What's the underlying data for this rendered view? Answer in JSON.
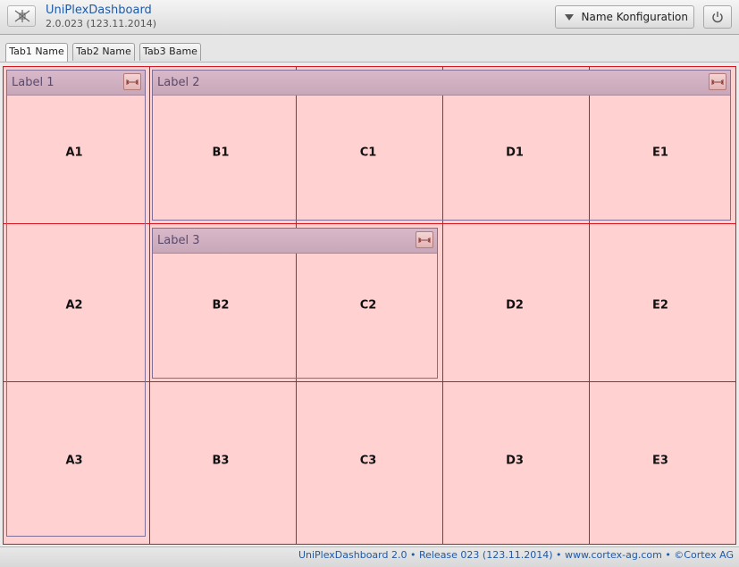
{
  "app": {
    "title": "UniPlexDashboard",
    "version": "2.0.023 (123.11.2014)"
  },
  "header": {
    "config_label": "Name Konfiguration"
  },
  "tabs": [
    {
      "label": "Tab1 Name",
      "active": true
    },
    {
      "label": "Tab2 Name"
    },
    {
      "label": "Tab3 Bame"
    }
  ],
  "panels": {
    "p1": "Label 1",
    "p2": "Label 2",
    "p3": "Label 3"
  },
  "cells": {
    "A1": "A1",
    "B1": "B1",
    "C1": "C1",
    "D1": "D1",
    "E1": "E1",
    "A2": "A2",
    "B2": "B2",
    "C2": "C2",
    "D2": "D2",
    "E2": "E2",
    "A3": "A3",
    "B3": "B3",
    "C3": "C3",
    "D3": "D3",
    "E3": "E3"
  },
  "footer": {
    "text": "UniPlexDashboard 2.0 • Release 023 (123.11.2014) • www.cortex-ag.com • ©Cortex AG"
  },
  "colors": {
    "grid_line": "#d8141e",
    "cell_fill": "#ffd1d1",
    "panel_header": "#cfb0c0",
    "link_blue": "#1e5aa8"
  },
  "icons": [
    "app-logo-icon",
    "dropdown-arrow-icon",
    "power-icon",
    "resize-horizontal-icon"
  ]
}
